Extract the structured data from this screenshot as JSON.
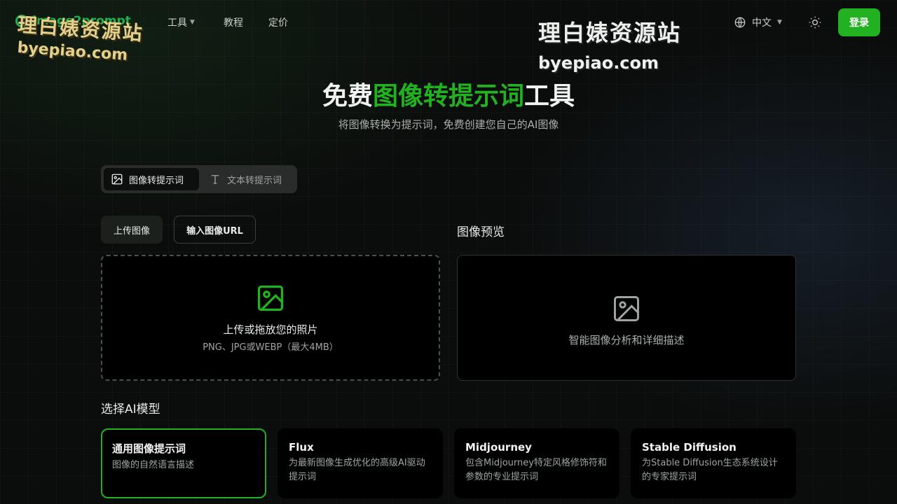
{
  "header": {
    "logo_text": "image2prompt",
    "nav": [
      {
        "label": "工具"
      },
      {
        "label": "教程"
      },
      {
        "label": "定价"
      }
    ],
    "language": "中文",
    "login_label": "登录"
  },
  "watermarks": {
    "left_cn": "理白婊资源站",
    "left_en": "byepiao.com",
    "center_cn": "理白婊资源站",
    "center_en": "byepiao.com"
  },
  "hero": {
    "title_pre": "免费",
    "title_accent": "图像转提示词",
    "title_post": "工具",
    "subtitle": "将图像转换为提示词，免费创建您自己的AI图像"
  },
  "mode_tabs": [
    {
      "label": "图像转提示词",
      "icon": "image-icon",
      "active": true
    },
    {
      "label": "文本转提示词",
      "icon": "text-icon",
      "active": false
    }
  ],
  "upload": {
    "upload_label": "上传图像",
    "url_label": "输入图像URL",
    "dropzone_title": "上传或拖放您的照片",
    "dropzone_hint": "PNG、JPG或WEBP（最大4MB）"
  },
  "preview": {
    "title": "图像预览",
    "placeholder": "智能图像分析和详细描述"
  },
  "models": {
    "title": "选择AI模型",
    "items": [
      {
        "name": "通用图像提示词",
        "desc": "图像的自然语言描述",
        "selected": true
      },
      {
        "name": "Flux",
        "desc": "为最新图像生成优化的高级AI驱动提示词",
        "selected": false
      },
      {
        "name": "Midjourney",
        "desc": "包含Midjourney特定风格修饰符和参数的专业提示词",
        "selected": false
      },
      {
        "name": "Stable Diffusion",
        "desc": "为Stable Diffusion生态系统设计的专家提示词",
        "selected": false
      }
    ]
  },
  "colors": {
    "accent": "#22b121",
    "background": "#0b0d0c"
  }
}
